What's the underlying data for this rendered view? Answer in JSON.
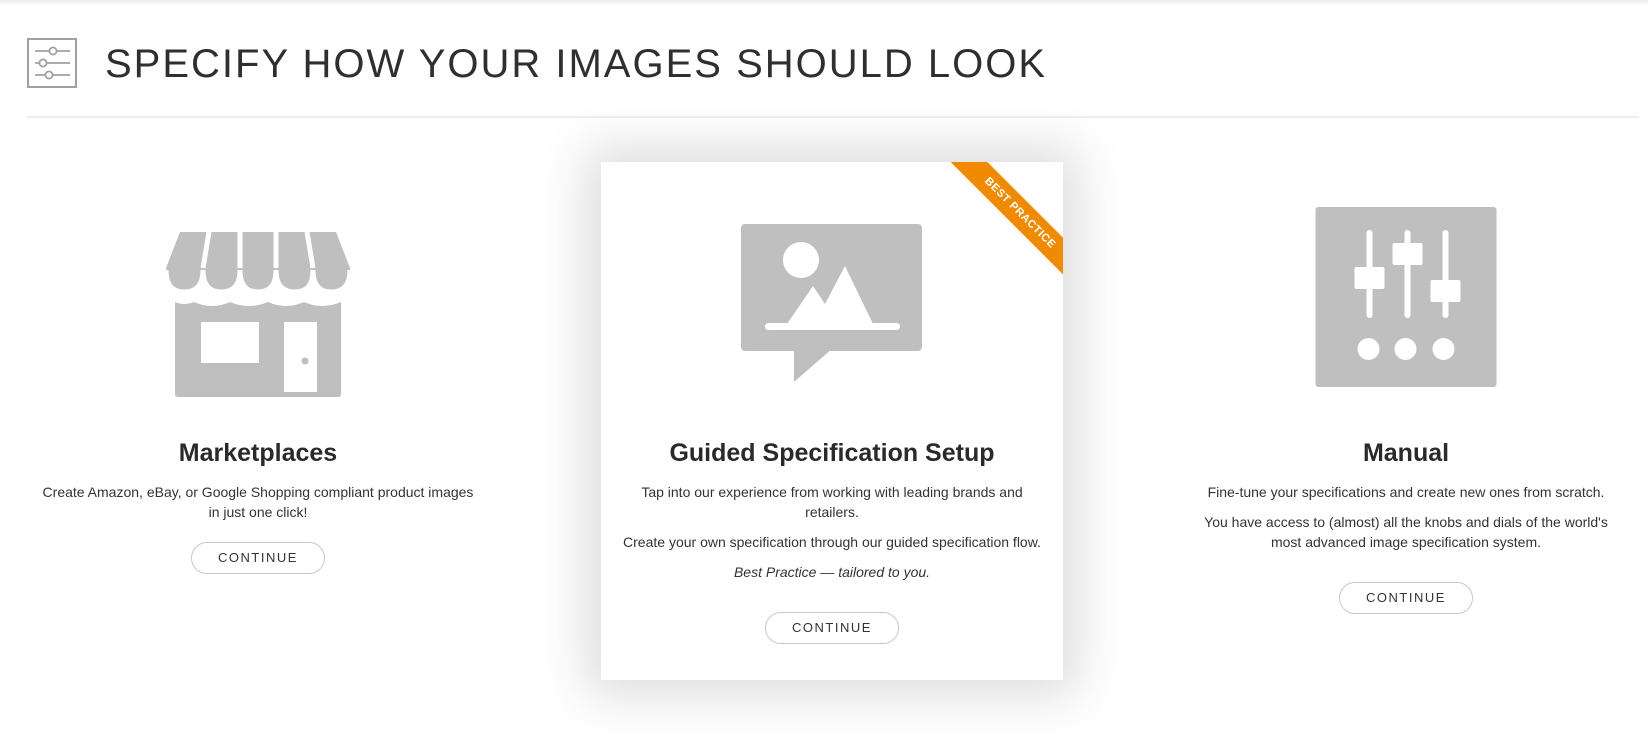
{
  "header": {
    "title": "SPECIFY HOW YOUR IMAGES SHOULD LOOK",
    "icon": "sliders-icon"
  },
  "cards": [
    {
      "id": "marketplaces",
      "icon": "storefront-icon",
      "title": "Marketplaces",
      "paragraphs": [
        "Create Amazon, eBay, or Google Shopping compliant product images in just one click!"
      ],
      "button_label": "CONTINUE"
    },
    {
      "id": "guided",
      "icon": "image-speech-icon",
      "ribbon": "BEST PRACTICE",
      "title": "Guided Specification Setup",
      "paragraphs": [
        "Tap into our experience from working with leading brands and retailers.",
        "Create your own specification through our guided specification flow.",
        "Best Practice — tailored to you."
      ],
      "button_label": "CONTINUE"
    },
    {
      "id": "manual",
      "icon": "mixer-sliders-icon",
      "title": "Manual",
      "paragraphs": [
        "Fine-tune your specifications and create new ones from scratch.",
        "You have access to (almost) all the knobs and dials of the world's most advanced image specification system."
      ],
      "button_label": "CONTINUE"
    }
  ],
  "colors": {
    "icon_gray": "#bfbfbf",
    "ribbon": "#f08a00",
    "border": "#c8c8c8"
  }
}
